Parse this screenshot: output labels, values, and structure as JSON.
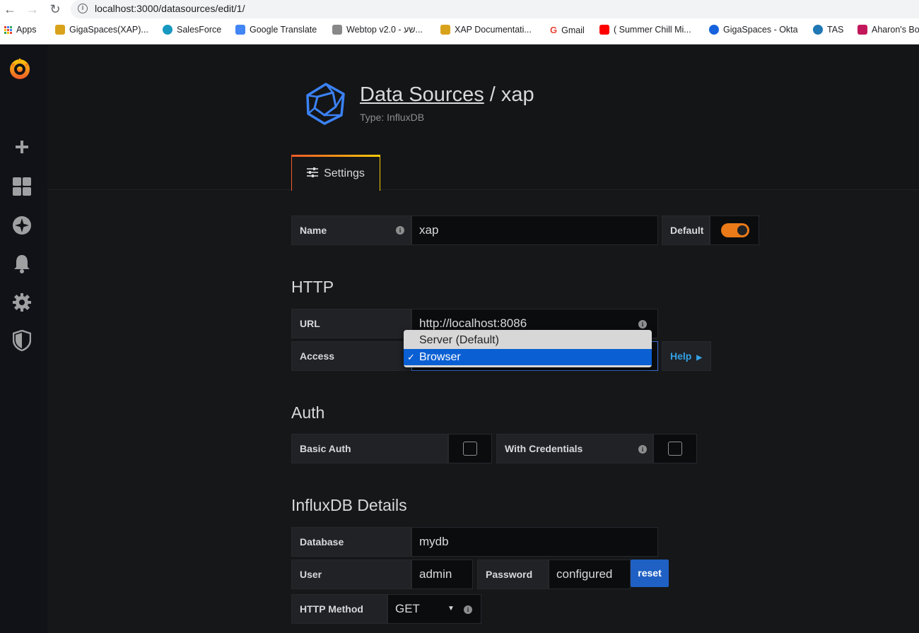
{
  "browser": {
    "url": "localhost:3000/datasources/edit/1/",
    "bookmarks": [
      {
        "label": "Apps",
        "color": "#4285f4"
      },
      {
        "label": "GigaSpaces(XAP)...",
        "color": "#d9a21b"
      },
      {
        "label": "SalesForce",
        "color": "#1798c1"
      },
      {
        "label": "Google Translate",
        "color": "#4285f4"
      },
      {
        "label": "Webtop v2.0 - שע...",
        "color": "#888888"
      },
      {
        "label": "XAP Documentati...",
        "color": "#d9a21b"
      },
      {
        "label": "Gmail",
        "color": "#ea4335"
      },
      {
        "label": "( Summer Chill Mi...",
        "color": "#ff0000"
      },
      {
        "label": "GigaSpaces - Okta",
        "color": "#1662dd"
      },
      {
        "label": "TAS",
        "color": "#1f77b4"
      },
      {
        "label": "Aharon's Bo",
        "color": "#c2185b"
      }
    ]
  },
  "sidebar": {
    "items": [
      "grafana-logo",
      "add-icon",
      "dashboards-icon",
      "explore-icon",
      "alerting-icon",
      "configuration-icon",
      "shield-icon"
    ]
  },
  "header": {
    "breadcrumb_link": "Data Sources",
    "separator": "/",
    "name": "xap",
    "type": "Type: InfluxDB",
    "tab_label": "Settings"
  },
  "form": {
    "name_label": "Name",
    "name_value": "xap",
    "default_label": "Default",
    "http_section": "HTTP",
    "url_label": "URL",
    "url_value": "http://localhost:8086",
    "access_label": "Access",
    "access_options": [
      "Server (Default)",
      "Browser"
    ],
    "access_selected": "Browser",
    "help_label": "Help",
    "auth_section": "Auth",
    "basic_auth_label": "Basic Auth",
    "with_credentials_label": "With Credentials",
    "influx_section": "InfluxDB Details",
    "database_label": "Database",
    "database_value": "mydb",
    "user_label": "User",
    "user_value": "admin",
    "password_label": "Password",
    "password_value": "configured",
    "reset_label": "reset",
    "http_method_label": "HTTP Method",
    "http_method_value": "GET"
  },
  "colors": {
    "accent_orange": "#eb7b18",
    "select_blue": "#0a5fd3",
    "reset_blue": "#1f60c4",
    "help_blue": "#33a2e5",
    "ds_logo_blue": "#3b82f6"
  }
}
